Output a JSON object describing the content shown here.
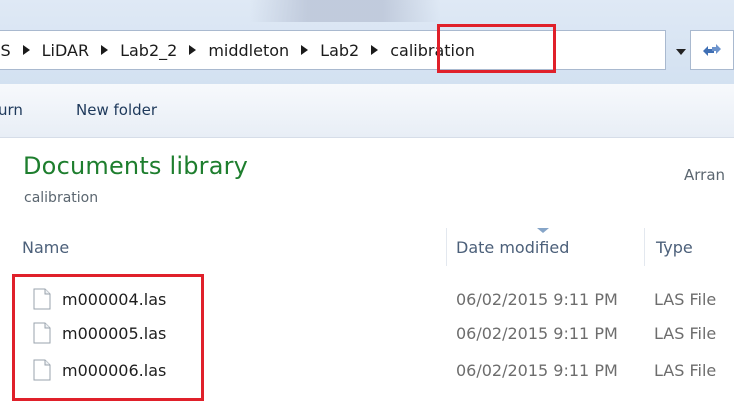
{
  "address_bar": {
    "crumbs": [
      "iS",
      "LiDAR",
      "Lab2_2",
      "middleton",
      "Lab2",
      "calibration"
    ]
  },
  "toolbar": {
    "burn_label": "urn",
    "new_folder_label": "New folder"
  },
  "library": {
    "title": "Documents library",
    "subtitle": "calibration",
    "arrange_label": "Arran"
  },
  "columns": {
    "name": "Name",
    "date_modified": "Date modified",
    "type": "Type"
  },
  "files": [
    {
      "name": "m000004.las",
      "date": "06/02/2015 9:11 PM",
      "type": "LAS File"
    },
    {
      "name": "m000005.las",
      "date": "06/02/2015 9:11 PM",
      "type": "LAS File"
    },
    {
      "name": "m000006.las",
      "date": "06/02/2015 9:11 PM",
      "type": "LAS File"
    }
  ],
  "colors": {
    "highlight": "#e0202a",
    "library_title": "#1e7e2e"
  },
  "icons": {
    "file": "file-icon",
    "dropdown": "chevron-down-icon",
    "refresh": "refresh-icon"
  }
}
